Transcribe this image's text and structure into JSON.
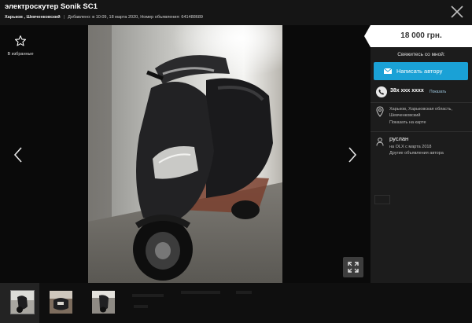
{
  "header": {
    "title": "электроскутер Sonik SC1",
    "location": "Харьков , Шевченковский",
    "added_prefix": "Добавлено: в 10:09, 18 марта 2020,",
    "ad_number_label": "Номер объявления:",
    "ad_number": "641488689"
  },
  "gallery": {
    "favorite_label": "В избранные",
    "thumbnails": [
      "photo-1",
      "photo-2",
      "photo-3"
    ],
    "active_index": 0
  },
  "sidebar": {
    "price": "18 000 грн.",
    "contact_label": "Свяжитесь со мной:",
    "write_button": "Написать автору",
    "phone": "38x xxx xxxx",
    "phone_show": "Показать",
    "location_text": "Харьков, Харьковская область, Шевченковский",
    "map_link": "Показать на карте",
    "user_name": "руслан",
    "user_since": "на OLX с марта 2018",
    "user_other_ads": "Другие объявления автора"
  },
  "colors": {
    "accent_button": "#1aa1d6",
    "price_tag_bg": "#ffffff",
    "background": "#121212",
    "sidebar_bg": "#1c1c1c"
  },
  "icons": [
    "star-icon",
    "close-icon",
    "chevron-left-icon",
    "chevron-right-icon",
    "expand-icon",
    "envelope-icon",
    "phone-icon",
    "map-pin-icon",
    "user-icon"
  ]
}
